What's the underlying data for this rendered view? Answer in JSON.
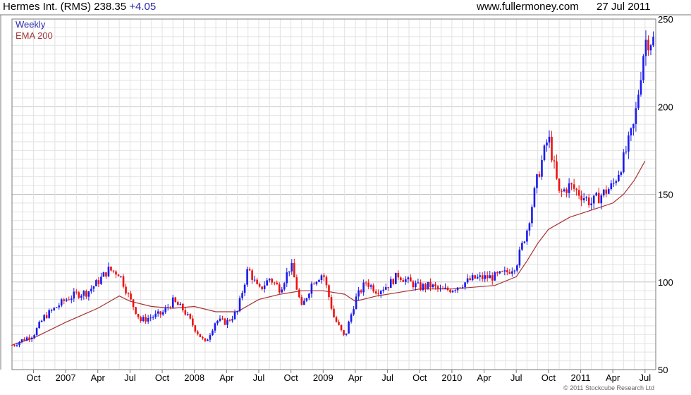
{
  "header": {
    "title": "Hermes Int. (RMS)",
    "price": "238.35",
    "change": "+4.05",
    "site": "www.fullermoney.com",
    "date": "27 Jul 2011"
  },
  "footer": {
    "copyright": "© 2011 Stockcube Research Ltd"
  },
  "colors": {
    "up": "#1a1aee",
    "down": "#ee1111",
    "ema": "#a83232",
    "major_grid": "#bfbfbf",
    "minor_grid": "#e2e2e2",
    "frame": "#7a7a7a"
  },
  "chart_data": {
    "type": "candlestick",
    "legend": [
      "Weekly",
      "EMA 200"
    ],
    "ylim": [
      50,
      250
    ],
    "ytick_labels": [
      "250",
      "200",
      "150",
      "100",
      "50"
    ],
    "y_axis_side": "right",
    "x_range": [
      "2006-08",
      "2011-08"
    ],
    "xtick_labels": [
      "Oct",
      "2007",
      "Apr",
      "Jul",
      "Oct",
      "2008",
      "Apr",
      "Jul",
      "Oct",
      "2009",
      "Apr",
      "Jul",
      "Oct",
      "2010",
      "Apr",
      "Jul",
      "Oct",
      "2011",
      "Apr",
      "Jul"
    ],
    "xtick_dates": [
      "2006-10",
      "2007-01",
      "2007-04",
      "2007-07",
      "2007-10",
      "2008-01",
      "2008-04",
      "2008-07",
      "2008-10",
      "2009-01",
      "2009-04",
      "2009-07",
      "2009-10",
      "2010-01",
      "2010-04",
      "2010-07",
      "2010-10",
      "2011-01",
      "2011-04",
      "2011-07"
    ],
    "grid": true,
    "legend_placement": "top-left",
    "series": [
      {
        "name": "Weekly",
        "kind": "candlestick",
        "path": [
          [
            "2006-08",
            64
          ],
          [
            "2006-10",
            70
          ],
          [
            "2006-11",
            80
          ],
          [
            "2007-01",
            90
          ],
          [
            "2007-02",
            93
          ],
          [
            "2007-03",
            94
          ],
          [
            "2007-04",
            100
          ],
          [
            "2007-05",
            107
          ],
          [
            "2007-06",
            105
          ],
          [
            "2007-07",
            90
          ],
          [
            "2007-08",
            78
          ],
          [
            "2007-09",
            80
          ],
          [
            "2007-10",
            82
          ],
          [
            "2007-11",
            89
          ],
          [
            "2007-12",
            84
          ],
          [
            "2008-01",
            74
          ],
          [
            "2008-02",
            65
          ],
          [
            "2008-03",
            78
          ],
          [
            "2008-04",
            77
          ],
          [
            "2008-05",
            83
          ],
          [
            "2008-06",
            108
          ],
          [
            "2008-07",
            95
          ],
          [
            "2008-08",
            102
          ],
          [
            "2008-09",
            96
          ],
          [
            "2008-10",
            110
          ],
          [
            "2008-11",
            85
          ],
          [
            "2008-12",
            100
          ],
          [
            "2009-01",
            105
          ],
          [
            "2009-02",
            80
          ],
          [
            "2009-03",
            68
          ],
          [
            "2009-04",
            90
          ],
          [
            "2009-05",
            100
          ],
          [
            "2009-06",
            95
          ],
          [
            "2009-07",
            98
          ],
          [
            "2009-08",
            104
          ],
          [
            "2009-09",
            100
          ],
          [
            "2009-10",
            97
          ],
          [
            "2009-11",
            98
          ],
          [
            "2009-12",
            95
          ],
          [
            "2010-01",
            96
          ],
          [
            "2010-03",
            102
          ],
          [
            "2010-05",
            103
          ],
          [
            "2010-06",
            105
          ],
          [
            "2010-07",
            110
          ],
          [
            "2010-08",
            130
          ],
          [
            "2010-09",
            160
          ],
          [
            "2010-10",
            183
          ],
          [
            "2010-11",
            150
          ],
          [
            "2010-12",
            155
          ],
          [
            "2011-01",
            150
          ],
          [
            "2011-02",
            145
          ],
          [
            "2011-03",
            150
          ],
          [
            "2011-04",
            155
          ],
          [
            "2011-05",
            170
          ],
          [
            "2011-06",
            190
          ],
          [
            "2011-07",
            238
          ]
        ]
      },
      {
        "name": "EMA 200",
        "kind": "line",
        "path": [
          [
            "2006-08",
            64
          ],
          [
            "2006-10",
            68
          ],
          [
            "2007-01",
            77
          ],
          [
            "2007-04",
            85
          ],
          [
            "2007-06",
            92
          ],
          [
            "2007-07",
            89
          ],
          [
            "2007-09",
            86
          ],
          [
            "2007-11",
            85
          ],
          [
            "2008-01",
            86
          ],
          [
            "2008-03",
            83
          ],
          [
            "2008-05",
            83
          ],
          [
            "2008-07",
            90
          ],
          [
            "2008-09",
            93
          ],
          [
            "2008-11",
            95
          ],
          [
            "2009-01",
            95
          ],
          [
            "2009-03",
            93
          ],
          [
            "2009-04",
            89
          ],
          [
            "2009-06",
            92
          ],
          [
            "2009-08",
            94
          ],
          [
            "2009-10",
            96
          ],
          [
            "2010-01",
            96
          ],
          [
            "2010-03",
            97
          ],
          [
            "2010-05",
            98
          ],
          [
            "2010-07",
            103
          ],
          [
            "2010-08",
            112
          ],
          [
            "2010-09",
            122
          ],
          [
            "2010-10",
            130
          ],
          [
            "2010-12",
            137
          ],
          [
            "2011-02",
            141
          ],
          [
            "2011-04",
            145
          ],
          [
            "2011-05",
            150
          ],
          [
            "2011-06",
            158
          ],
          [
            "2011-07",
            169
          ]
        ]
      }
    ]
  }
}
